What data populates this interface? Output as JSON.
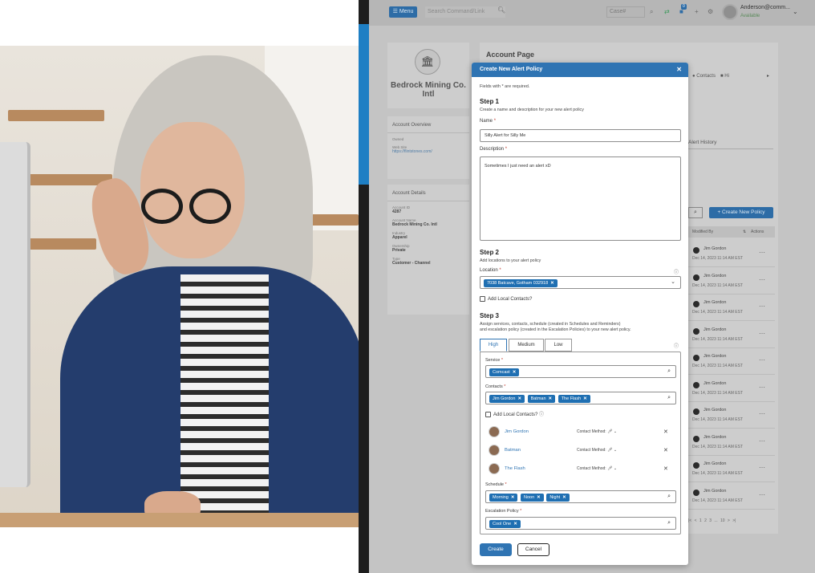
{
  "topbar": {
    "menu_label": "☰ Menu",
    "command_placeholder": "Search Command/Link",
    "case_placeholder": "Case#",
    "notification_count": "0",
    "user_name": "Anderson@comm...",
    "user_status": "Available"
  },
  "account": {
    "name": "Bedrock Mining Co. Intl",
    "overview_title": "Account Overview",
    "overview": [
      {
        "key": "Owned",
        "value": ""
      },
      {
        "key": "Web Site",
        "value": "https://flintstones.com/"
      }
    ],
    "details_title": "Account Details",
    "details": [
      {
        "key": "Account ID",
        "value": "4287"
      },
      {
        "key": "Account Name",
        "value": "Bedrock Mining Co. Intl"
      },
      {
        "key": "Industry",
        "value": "Apparel"
      },
      {
        "key": "Ownership",
        "value": "Private"
      },
      {
        "key": "Type",
        "value": "Customer - Channel"
      }
    ]
  },
  "main": {
    "title": "Account Page",
    "tab_contacts": "Contacts",
    "tab_hi": "Hi",
    "alert_history": "Alert History",
    "create_policy_label": "+ Create New Policy",
    "col_modified_by": "Modified By",
    "col_actions": "Actions",
    "rows": [
      {
        "name": "Jim Gordon",
        "date": "Dec 14, 2023 11:14 AM EST"
      },
      {
        "name": "Jim Gordon",
        "date": "Dec 14, 2023 11:14 AM EST"
      },
      {
        "name": "Jim Gordon",
        "date": "Dec 14, 2023 11:14 AM EST"
      },
      {
        "name": "Jim Gordon",
        "date": "Dec 14, 2023 11:14 AM EST"
      },
      {
        "name": "Jim Gordon",
        "date": "Dec 14, 2023 11:14 AM EST"
      },
      {
        "name": "Jim Gordon",
        "date": "Dec 14, 2023 11:14 AM EST"
      },
      {
        "name": "Jim Gordon",
        "date": "Dec 14, 2023 11:14 AM EST"
      },
      {
        "name": "Jim Gordon",
        "date": "Dec 14, 2023 11:14 AM EST"
      },
      {
        "name": "Jim Gordon",
        "date": "Dec 14, 2023 11:14 AM EST"
      },
      {
        "name": "Jim Gordon",
        "date": "Dec 14, 2023 11:14 AM EST"
      }
    ],
    "pagination": "|< < 1 2 3 ... 10 > >|"
  },
  "modal": {
    "title": "Create New Alert Policy",
    "required_note": "Fields with * are required.",
    "step1": {
      "heading": "Step 1",
      "desc": "Create a name and description for your new alert policy",
      "name_label": "Name",
      "name_value": "Silly Alert for Silly Me",
      "desc_label": "Description",
      "desc_value": "Sometimes I just need an alert xD"
    },
    "step2": {
      "heading": "Step 2",
      "desc": "Add locations to your alert policy",
      "location_label": "Location",
      "location_chip": "7038 Batcave, Gotham 032918",
      "local_contacts_label": "Add Local Contacts?"
    },
    "step3": {
      "heading": "Step 3",
      "desc_line1": "Assign services, contacts, schedule (created in Schedules and Reminders)",
      "desc_line2": "and escalation policy (created in the Escalation Policies) to your new alert policy.",
      "tabs": [
        "High",
        "Medium",
        "Low"
      ],
      "service_label": "Service",
      "service_chips": [
        "Comcast"
      ],
      "contacts_label": "Contacts",
      "contact_chips": [
        "Jim Gordon",
        "Batman",
        "The Flash"
      ],
      "local_contacts_label": "Add Local Contacts?",
      "contact_list": [
        {
          "name": "Jim Gordon",
          "method": "Contact Method:"
        },
        {
          "name": "Batman",
          "method": "Contact Method:"
        },
        {
          "name": "The Flash",
          "method": "Contact Method:"
        }
      ],
      "schedule_label": "Schedule",
      "schedule_chips": [
        "Morning",
        "Noon",
        "Night"
      ],
      "escalation_label": "Escalation Policy",
      "escalation_chips": [
        "Cool One"
      ]
    },
    "create_label": "Create",
    "cancel_label": "Cancel"
  },
  "colors": {
    "primary": "#2f74b3",
    "chip": "#1f6fb2",
    "jacket": "#243d6d"
  }
}
